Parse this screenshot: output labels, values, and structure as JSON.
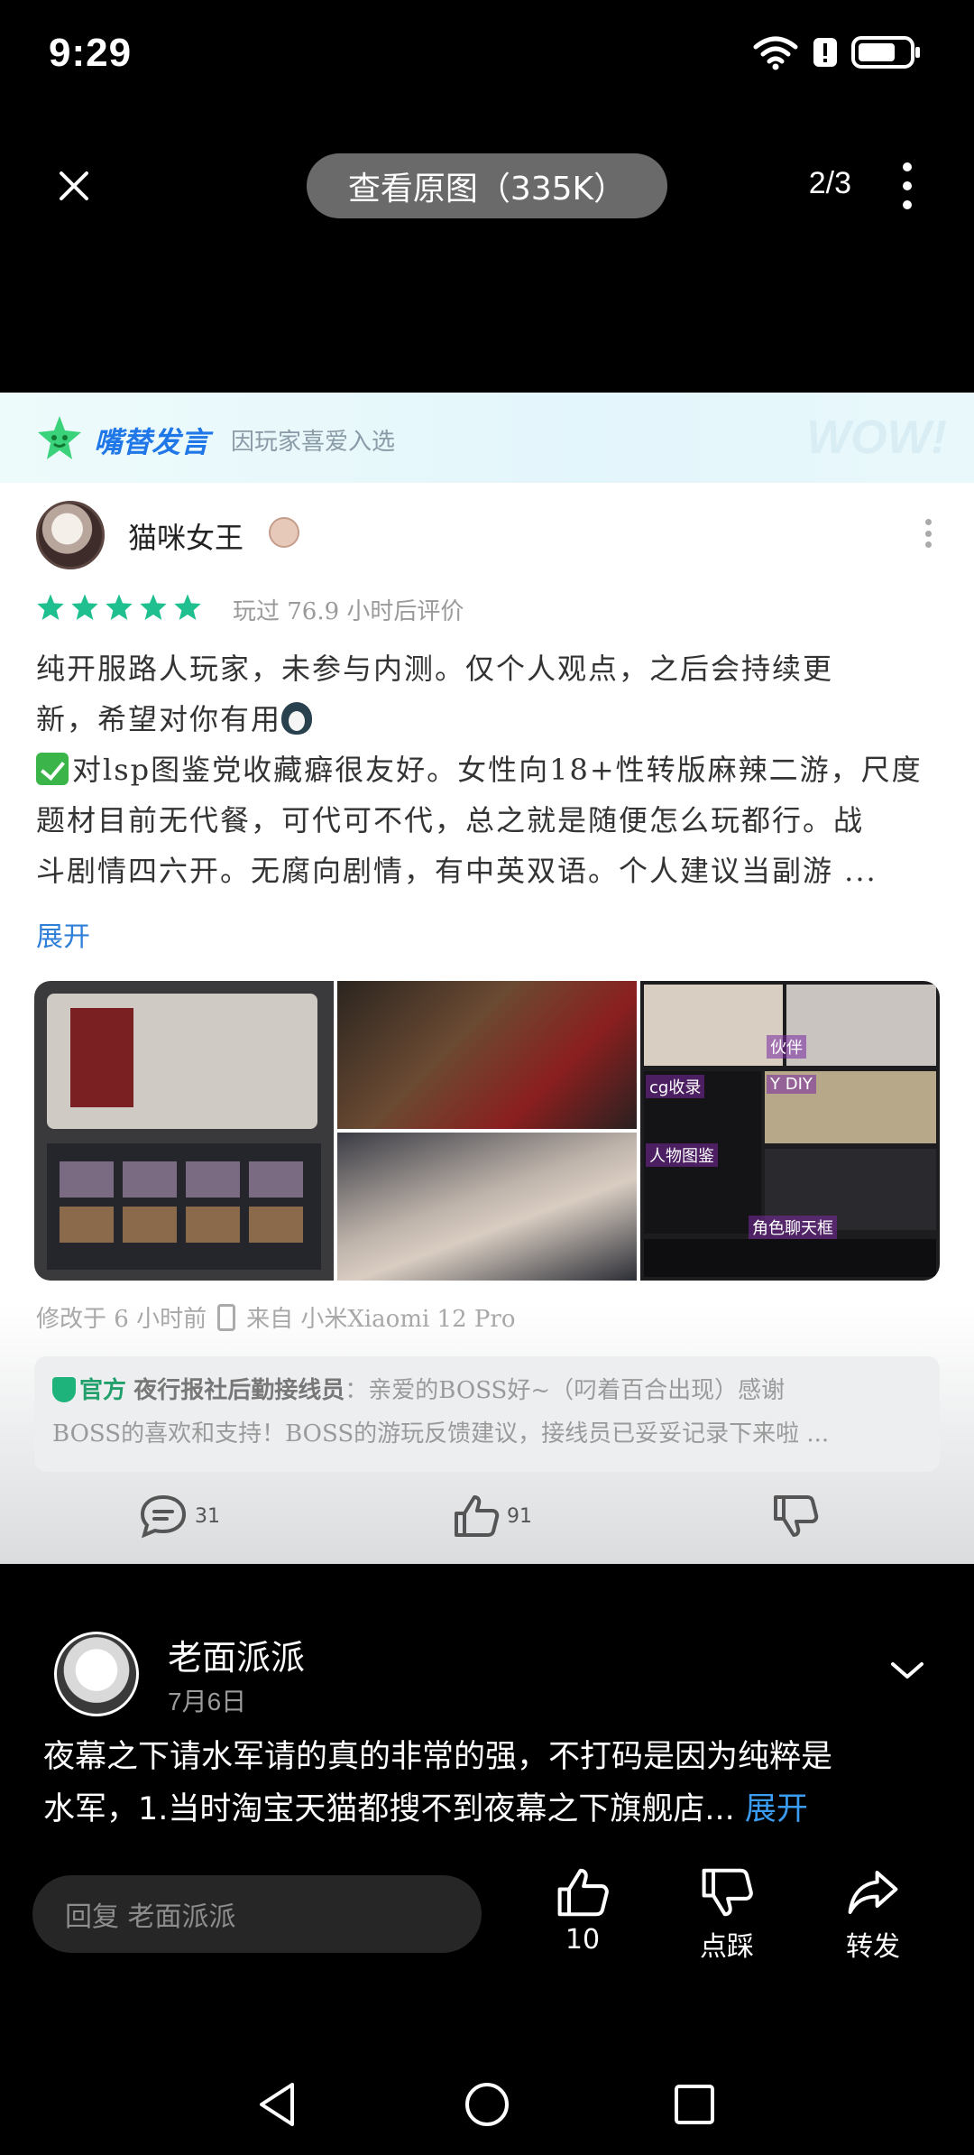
{
  "status_bar": {
    "time": "9:29",
    "icons": [
      "wifi-icon",
      "alert-icon",
      "battery-icon"
    ]
  },
  "viewer": {
    "view_original_label": "查看原图（335K）",
    "page_counter": "2/3",
    "icons": [
      "close-icon",
      "more-vert-icon"
    ]
  },
  "image": {
    "header": {
      "title": "嘴替发言",
      "subtitle": "因玩家喜爱入选",
      "watermark": "WOW!"
    },
    "reviewer": {
      "name": "猫咪女王",
      "rating": 5,
      "play_time": "玩过 76.9 小时后评价"
    },
    "review_lines": [
      "纯开服路人玩家，未参与内测。仅个人观点，之后会持续更",
      "新，希望对你有用",
      "对lsp图鉴党收藏癖很友好。女性向18+性转版麻辣二游，尺度",
      "题材目前无代餐，可代可不代，总之就是随便怎么玩都行。战",
      "斗剧情四六开。无腐向剧情，有中英双语。个人建议当副游 ..."
    ],
    "expand_label": "展开",
    "gallery_labels": [
      "cg收录",
      "伙伴",
      "Y DIY",
      "人物图鉴",
      "角色聊天框"
    ],
    "edited": "修改于 6 小时前",
    "device": "来自 小米Xiaomi 12 Pro",
    "official_reply": {
      "tag": "官方",
      "name": "夜行报社后勤接线员",
      "text_line1": "：亲爱的BOSS好~（叼着百合出现）感谢",
      "text_line2": "BOSS的喜欢和支持！BOSS的游玩反馈建议，接线员已妥妥记录下来啦 ..."
    },
    "actions": {
      "comments": "31",
      "likes": "91"
    },
    "colors": {
      "brand_blue": "#1f77e8",
      "star_green": "#1fbf8f",
      "official_green": "#22a06b"
    }
  },
  "comment": {
    "author": "老面派派",
    "date": "7月6日",
    "body_line1": "夜幕之下请水军请的真的非常的强，不打码是因为纯粹是",
    "body_line2": "水军，1.当时淘宝天猫都搜不到夜幕之下旗舰店...",
    "expand_label": "展开"
  },
  "bottom_bar": {
    "reply_placeholder": "回复 老面派派",
    "like_count": "10",
    "dislike_label": "点踩",
    "share_label": "转发"
  },
  "nav": {
    "icons": [
      "back-triangle-icon",
      "home-circle-icon",
      "recents-square-icon"
    ]
  }
}
